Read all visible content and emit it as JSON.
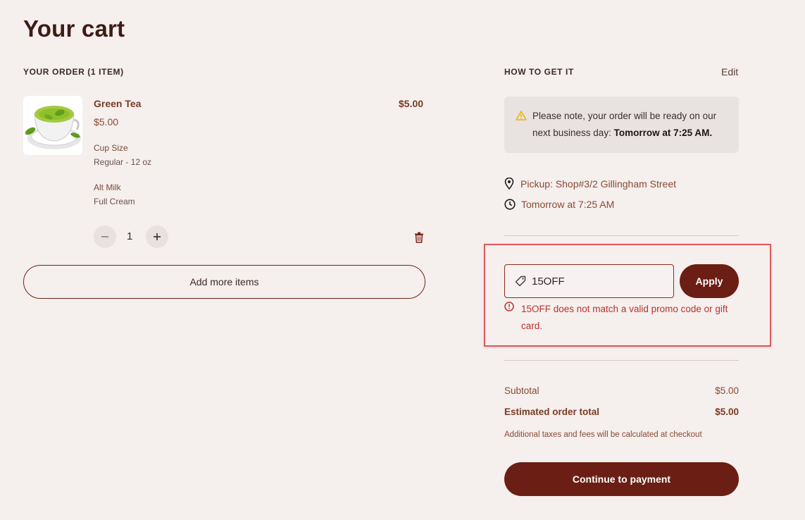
{
  "page": {
    "title": "Your cart"
  },
  "order": {
    "heading": "YOUR ORDER (1 ITEM)",
    "items": [
      {
        "name": "Green Tea",
        "price": "$5.00",
        "line_total": "$5.00",
        "image_icon": "green-tea-cup",
        "options": [
          {
            "label": "Cup Size",
            "value": "Regular - 12 oz"
          },
          {
            "label": "Alt Milk",
            "value": "Full Cream"
          }
        ],
        "quantity": "1"
      }
    ],
    "add_more_label": "Add more items"
  },
  "fulfillment": {
    "heading": "HOW TO GET IT",
    "edit_label": "Edit",
    "notice_line1": "Please note, your order will be ready on our",
    "notice_line2_prefix": "next business day: ",
    "notice_line2_bold": "Tomorrow at 7:25 AM.",
    "pickup": "Pickup: Shop#3/2 Gillingham Street",
    "time": "Tomorrow at 7:25 AM"
  },
  "promo": {
    "value": "15OFF",
    "apply_label": "Apply",
    "error": "15OFF does not match a valid promo code or gift card."
  },
  "summary": {
    "subtotal_label": "Subtotal",
    "subtotal_value": "$5.00",
    "total_label": "Estimated order total",
    "total_value": "$5.00",
    "fees_note": "Additional taxes and fees will be calculated at checkout",
    "continue_label": "Continue to payment"
  },
  "colors": {
    "background": "#f5efee",
    "brand": "#6b1f14",
    "accent_text": "#8a4a30",
    "error": "#b8332c",
    "warning": "#f0b400",
    "highlight": "#e05a5a"
  }
}
